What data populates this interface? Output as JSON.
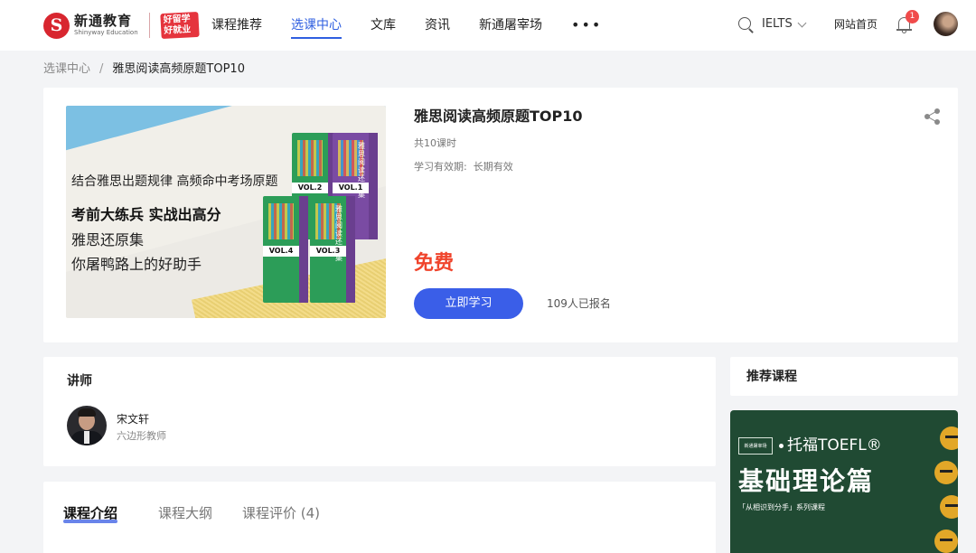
{
  "header": {
    "brand_cn": "新通教育",
    "brand_en": "Shinyway Education",
    "badge_text": "好留学 好就业",
    "nav": [
      {
        "label": "课程推荐",
        "active": false
      },
      {
        "label": "选课中心",
        "active": true
      },
      {
        "label": "文库",
        "active": false
      },
      {
        "label": "资讯",
        "active": false
      },
      {
        "label": "新通屠宰场",
        "active": false
      }
    ],
    "more_label": "•••",
    "language": "IELTS",
    "home_link": "网站首页",
    "notification_count": "1"
  },
  "breadcrumb": {
    "parent": "选课中心",
    "separator": "/",
    "current": "雅思阅读高频原题TOP10"
  },
  "course": {
    "title": "雅思阅读高频原题TOP10",
    "lessons": "共10课时",
    "validity_label": "学习有效期:",
    "validity_value": "长期有效",
    "price": "免费",
    "study_button": "立即学习",
    "enrolled": "109人已报名",
    "banner": {
      "line1": "结合雅思出题规律  高频命中考场原题",
      "line2": "考前大练兵 实战出高分",
      "line3": "雅思还原集",
      "line4": "你屠鸭路上的好助手",
      "book_title": "雅思阅读还原集",
      "volumes": [
        "VOL.2",
        "VOL.1",
        "VOL.4",
        "VOL.3"
      ]
    }
  },
  "teacher": {
    "section_title": "讲师",
    "name": "宋文轩",
    "role": "六边形教师"
  },
  "tabs": [
    {
      "label": "课程介绍",
      "active": true
    },
    {
      "label": "课程大纲",
      "active": false
    },
    {
      "label": "课程评价 (4)",
      "active": false
    }
  ],
  "recommended": {
    "title": "推荐课程",
    "card": {
      "logo_text": "新通屠宰场",
      "subject": "托福TOEFL®",
      "main_title": "基础理论篇",
      "subtitle": "「从相识到分手」系列课程"
    }
  },
  "colors": {
    "primary": "#3a5ee8",
    "price": "#f0442c",
    "brand_red": "#d8262f",
    "rec_bg": "#204a33"
  }
}
